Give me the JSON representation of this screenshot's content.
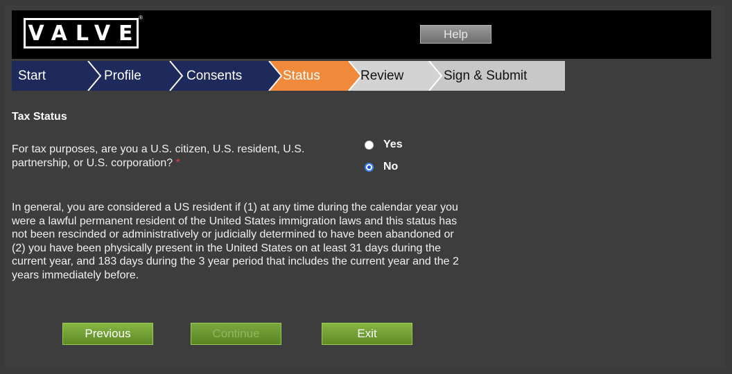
{
  "header": {
    "logo_text": "VALVE",
    "logo_mark": "®",
    "help_label": "Help"
  },
  "steps": [
    {
      "label": "Start",
      "state": "done"
    },
    {
      "label": "Profile",
      "state": "done"
    },
    {
      "label": "Consents",
      "state": "done"
    },
    {
      "label": "Status",
      "state": "active"
    },
    {
      "label": "Review",
      "state": "upcoming"
    },
    {
      "label": "Sign & Submit",
      "state": "upcoming"
    }
  ],
  "colors": {
    "step_done": "#1f2a5c",
    "step_active": "#f08a3a",
    "step_upcoming": "#c8c8c8",
    "button_green": "#6f9d31"
  },
  "section_title": "Tax Status",
  "question": {
    "text": "For tax purposes, are you a U.S. citizen, U.S. resident, U.S. partnership, or U.S. corporation?",
    "required_mark": "*"
  },
  "options": [
    {
      "label": "Yes",
      "checked": false
    },
    {
      "label": "No",
      "checked": true
    }
  ],
  "info_text": "In general, you are considered a US resident if (1) at any time during the calendar year you were a lawful permanent resident of the United States immigration laws and this status has not been rescinded or administratively or judicially determined to have been abandoned or (2) you have been physically present in the United States on at least 31 days during the current year, and 183 days during the 3 year period that includes the current year and the 2 years immediately before.",
  "buttons": {
    "previous": "Previous",
    "continue": "Continue",
    "exit": "Exit"
  }
}
